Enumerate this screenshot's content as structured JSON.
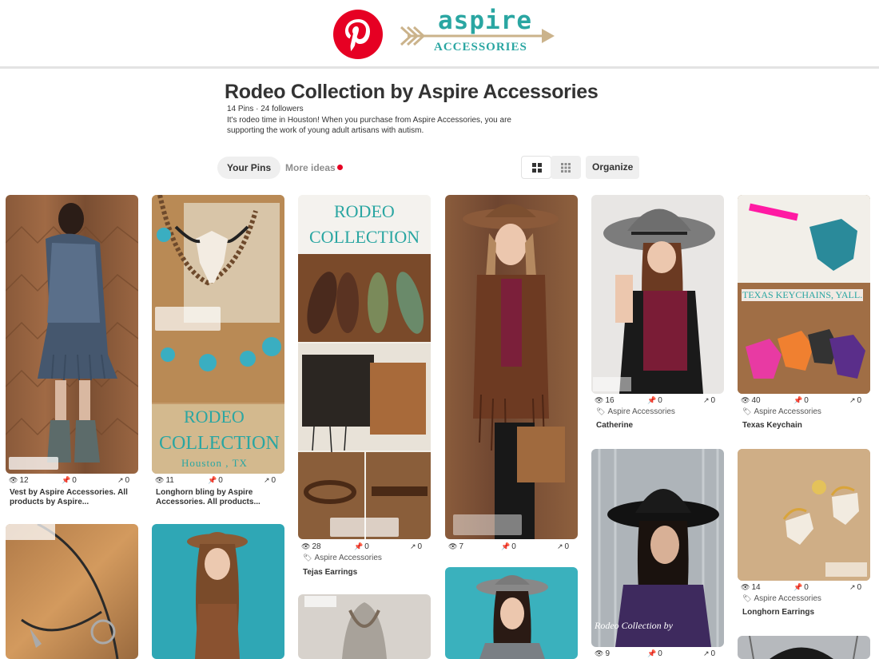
{
  "brand": {
    "name": "aspire",
    "subtitle": "ACCESSORIES"
  },
  "board": {
    "title": "Rodeo Collection by Aspire Accessories",
    "stats": "14 Pins · 24 followers",
    "description": "It's rodeo time in Houston! When you purchase from Aspire Accessories, you are supporting the work of young adult artisans with autism."
  },
  "tabs": {
    "your_pins": "Your Pins",
    "more_ideas": "More ideas"
  },
  "organize_label": "Organize",
  "colors": {
    "pinterest_red": "#e60023",
    "aspire_teal": "#2aa6a2",
    "arrow_tan": "#cbb38b"
  },
  "pins": [
    {
      "id": "vest",
      "views": "12",
      "saves": "0",
      "clicks": "0",
      "title": "Vest by Aspire Accessories. All products by Aspire..."
    },
    {
      "id": "longhorn-bling",
      "views": "11",
      "saves": "0",
      "clicks": "0",
      "title": "Longhorn bling by Aspire Accessories. All products...",
      "overlay_line1": "RODEO",
      "overlay_line2": "COLLECTION",
      "overlay_line3": "Houston , TX"
    },
    {
      "id": "tejas",
      "views": "28",
      "saves": "0",
      "clicks": "0",
      "tag": "Aspire Accessories",
      "title": "Tejas Earrings",
      "overlay_line1": "RODEO",
      "overlay_line2": "COLLECTION"
    },
    {
      "id": "cowgirl",
      "views": "7",
      "saves": "0",
      "clicks": "0"
    },
    {
      "id": "catherine",
      "views": "16",
      "saves": "0",
      "clicks": "0",
      "tag": "Aspire Accessories",
      "title": "Catherine"
    },
    {
      "id": "keychain",
      "views": "40",
      "saves": "0",
      "clicks": "0",
      "tag": "Aspire Accessories",
      "title": "Texas Keychain",
      "overlay_line1": "TEXAS KEYCHAINS, YALL."
    },
    {
      "id": "black-hat",
      "views": "9",
      "saves": "0",
      "clicks": "0",
      "overlay_line1": "Rodeo Collection by"
    },
    {
      "id": "longhorn-earrings",
      "views": "14",
      "saves": "0",
      "clicks": "0",
      "tag": "Aspire Accessories",
      "title": "Longhorn Earrings"
    }
  ]
}
